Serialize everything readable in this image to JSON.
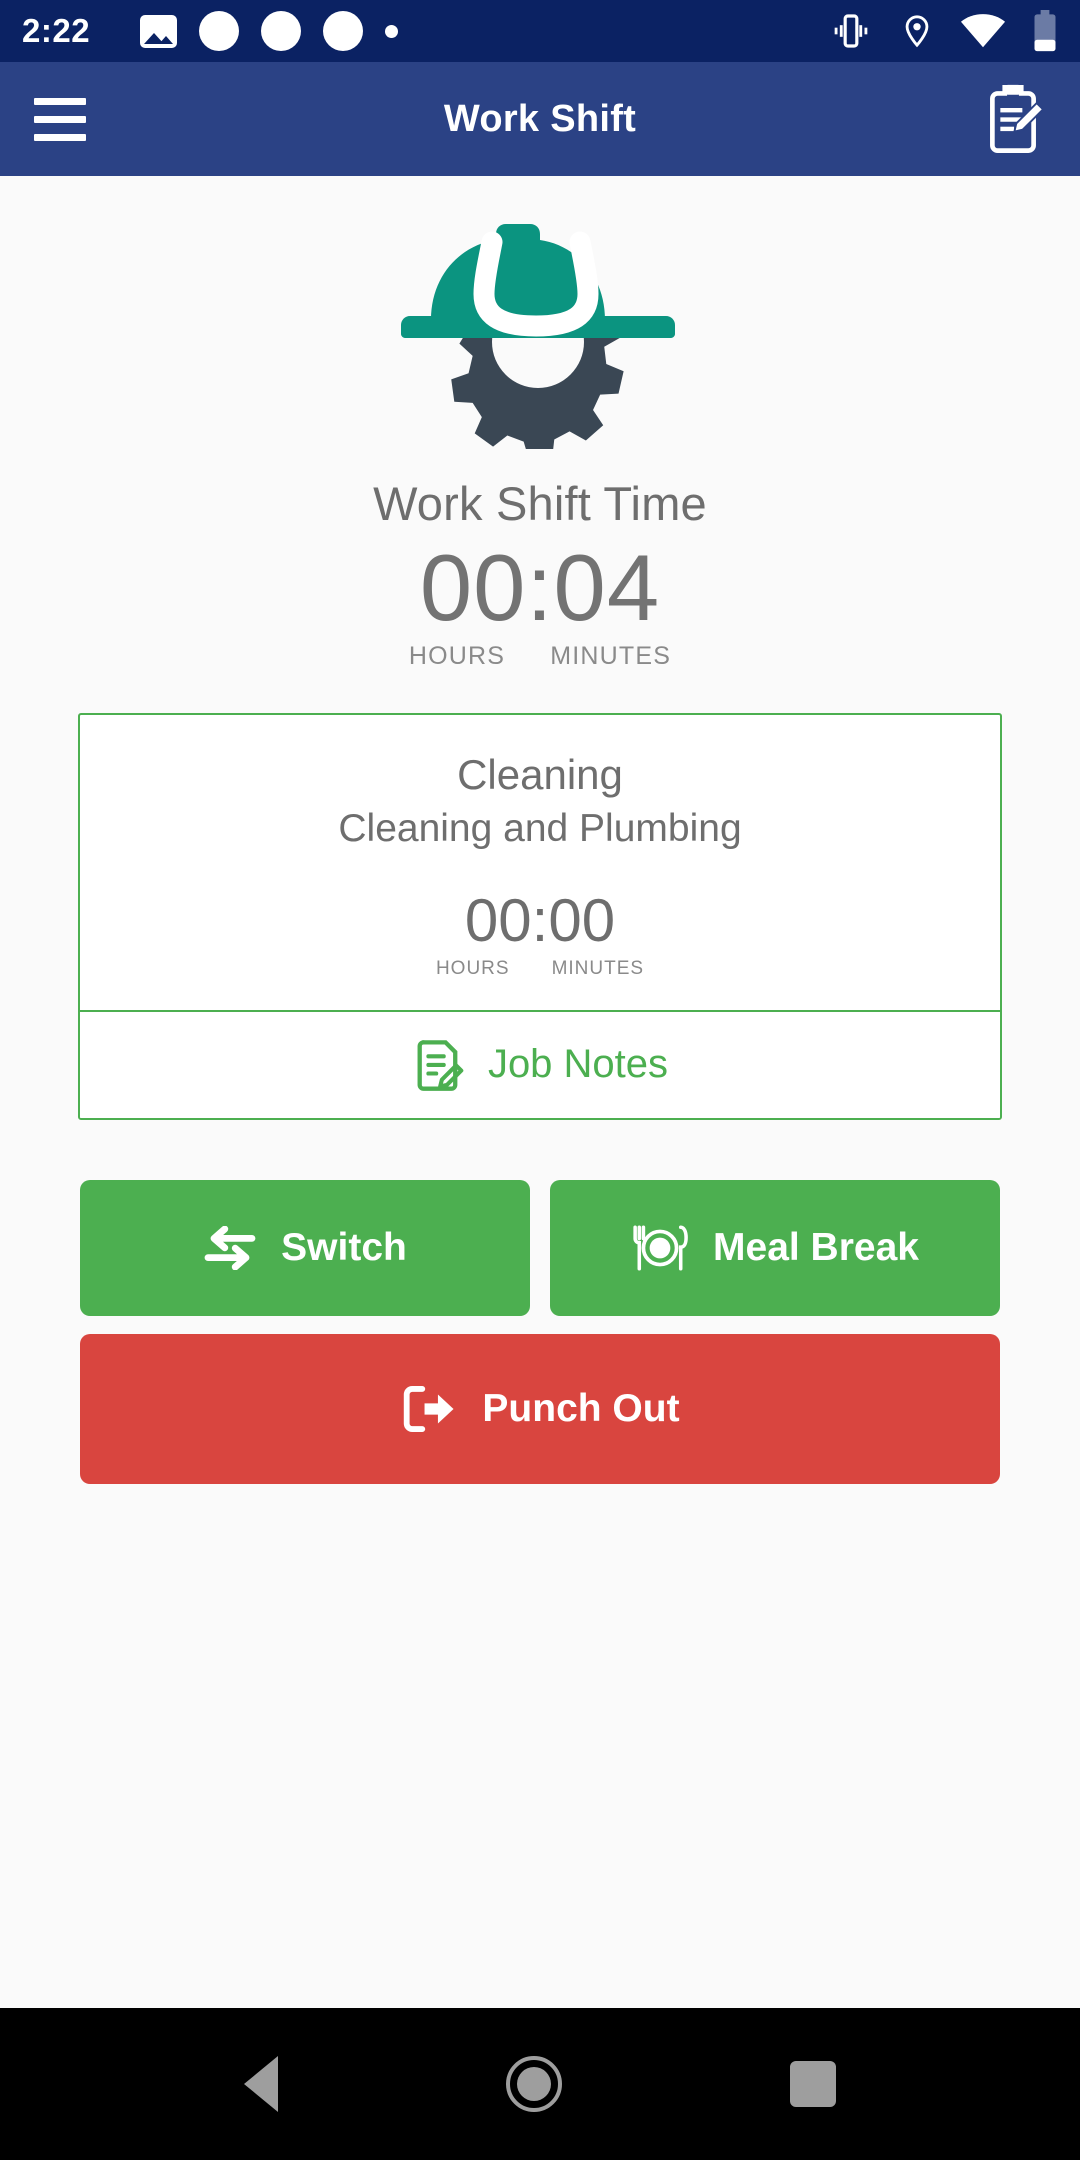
{
  "status_bar": {
    "time": "2:22",
    "left_icons": [
      "image-icon",
      "circle-notification-icon",
      "circle-notification-icon",
      "circle-notification-icon",
      "dot-notification-icon"
    ],
    "right_icons": [
      "vibrate-icon",
      "location-icon",
      "wifi-icon",
      "battery-icon"
    ],
    "background_color": "#0b2263"
  },
  "app_bar": {
    "title": "Work Shift",
    "menu_icon": "hamburger-menu-icon",
    "action_icon": "clipboard-edit-icon",
    "background_color": "#2b4285"
  },
  "logo": {
    "name": "hardhat-gear-logo",
    "helmet_color": "#0b9480",
    "gear_color": "#3a4754"
  },
  "shift": {
    "title": "Work Shift Time",
    "time": "00:04",
    "hours_label": "HOURS",
    "minutes_label": "MINUTES"
  },
  "job_card": {
    "name": "Cleaning",
    "description": "Cleaning and Plumbing",
    "time": "00:00",
    "hours_label": "HOURS",
    "minutes_label": "MINUTES",
    "notes_label": "Job Notes",
    "notes_icon": "note-edit-icon",
    "border_color": "#4caf50"
  },
  "actions": {
    "switch": {
      "label": "Switch",
      "icon": "swap-arrows-icon",
      "color": "#4caf50"
    },
    "meal_break": {
      "label": "Meal Break",
      "icon": "cutlery-plate-icon",
      "color": "#4caf50"
    },
    "punch_out": {
      "label": "Punch Out",
      "icon": "exit-arrow-icon",
      "color": "#d9453f"
    }
  },
  "nav_bar": {
    "back": "back-triangle-icon",
    "home": "home-circle-icon",
    "recents": "recents-square-icon"
  }
}
